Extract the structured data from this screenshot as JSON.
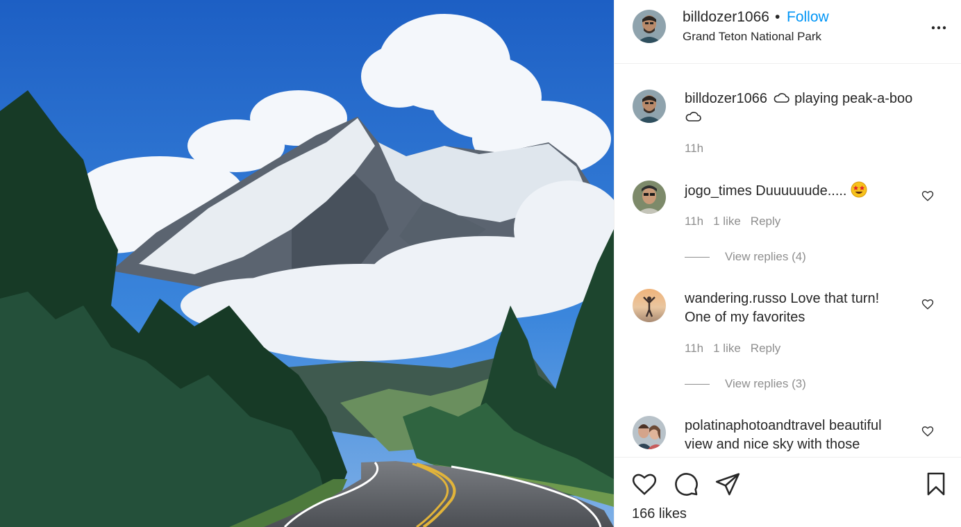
{
  "post": {
    "username": "billdozer1066",
    "separator": "•",
    "follow_label": "Follow",
    "location": "Grand Teton National Park",
    "more_icon": "more-horizontal-icon",
    "photo_description_icon": "landscape-photo"
  },
  "caption": {
    "username": "billdozer1066",
    "text_part1": "playing peak-a-boo",
    "cloud_icon": "cloud-icon",
    "time": "11h"
  },
  "comments": [
    {
      "username": "jogo_times",
      "text": "Duuuuuude.....",
      "emoji": "star-struck-emoji",
      "time": "11h",
      "likes": "1 like",
      "reply_label": "Reply",
      "view_replies": "View replies (4)"
    },
    {
      "username": "wandering.russo",
      "text": "Love that turn!",
      "text_line2": "One of my favorites",
      "time": "11h",
      "likes": "1 like",
      "reply_label": "Reply",
      "view_replies": "View replies (3)"
    },
    {
      "username": "polatinaphotoandtravel",
      "text": "beautiful",
      "text_line2": "view and nice sky with those"
    }
  ],
  "footer": {
    "likes_count": "166 likes"
  },
  "colors": {
    "follow": "#0095f6",
    "text": "#262626",
    "secondary": "#8e8e8e",
    "border": "#efefef"
  }
}
